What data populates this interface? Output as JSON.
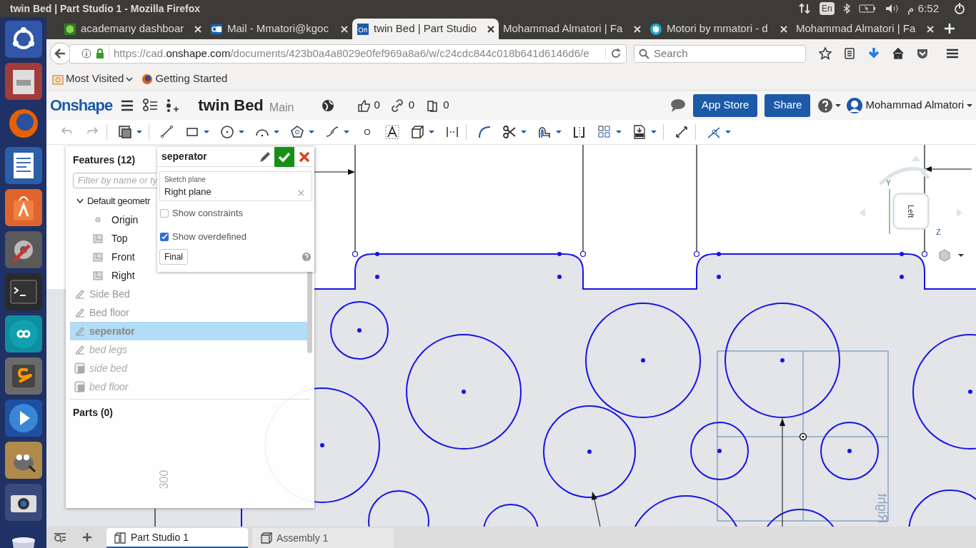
{
  "os_bar": {
    "window_title": "twin Bed | Part Studio 1 - Mozilla Firefox",
    "keyboard": "En",
    "clock_period": "م",
    "clock_time": "6:52"
  },
  "browser_tabs": [
    {
      "title": "academany dashboar",
      "selected": false,
      "kind": "cube"
    },
    {
      "title": "Mail - Mmatori@kgoc",
      "selected": false,
      "kind": "mail"
    },
    {
      "title": "twin Bed | Part Studio",
      "selected": true,
      "kind": "onshape"
    },
    {
      "title": "Mohammad Almatori | Fa",
      "selected": false,
      "kind": "none"
    },
    {
      "title": "Motori by mmatori - d",
      "selected": false,
      "kind": "sketchfab"
    },
    {
      "title": "Mohammad Almatori | Fa",
      "selected": false,
      "kind": "none"
    }
  ],
  "address_bar": {
    "scheme": "https://cad.",
    "host": "onshape.com",
    "path": "/documents/423b0a4a8029e0fef969a8a6/w/c24cdc844c018b641d6146d6/e"
  },
  "search": {
    "placeholder": "Search"
  },
  "bookmarks": [
    "Most Visited",
    "Getting Started"
  ],
  "onshape_header": {
    "logo": "Onshape",
    "document": "twin Bed",
    "branch": "Main",
    "likes": "0",
    "links": "0",
    "copies": "0",
    "buttons": [
      "App Store",
      "Share"
    ],
    "user": "Mohammad Almatori"
  },
  "feature_panel": {
    "title": "Features (12)",
    "filter_placeholder": "Filter by name or ty",
    "tree": [
      {
        "label": "Default geometr",
        "kind": "folder",
        "expanded": true,
        "children": [
          {
            "label": "Origin",
            "kind": "point"
          },
          {
            "label": "Top",
            "kind": "plane"
          },
          {
            "label": "Front",
            "kind": "plane"
          },
          {
            "label": "Right",
            "kind": "plane"
          }
        ]
      },
      {
        "label": "Side Bed",
        "kind": "sketch",
        "selected": false,
        "rolled_back": false
      },
      {
        "label": "Bed floor",
        "kind": "sketch",
        "selected": false,
        "rolled_back": false
      },
      {
        "label": "seperator",
        "kind": "sketch",
        "selected": true,
        "rolled_back": false
      },
      {
        "label": "bed legs",
        "kind": "sketch",
        "selected": false,
        "rolled_back": true
      },
      {
        "label": "side bed",
        "kind": "extrude",
        "selected": false,
        "rolled_back": true
      },
      {
        "label": "bed floor",
        "kind": "extrude",
        "selected": false,
        "rolled_back": true
      }
    ],
    "parts": "Parts (0)"
  },
  "sketch_dialog": {
    "title": "seperator",
    "field_label": "Sketch plane",
    "field_value": "Right plane",
    "options": [
      {
        "label": "Show constraints",
        "checked": false
      },
      {
        "label": "Show overdefined",
        "checked": true
      }
    ],
    "button": "Final"
  },
  "view_cube": {
    "face": "Left",
    "axes": [
      "Y",
      "Z"
    ]
  },
  "canvas": {
    "dimension": "300",
    "plane_label": "Right"
  },
  "bottom_tabs": [
    {
      "label": "Part Studio 1",
      "selected": true,
      "kind": "part_studio"
    },
    {
      "label": "Assembly 1",
      "selected": false,
      "kind": "assembly"
    }
  ]
}
